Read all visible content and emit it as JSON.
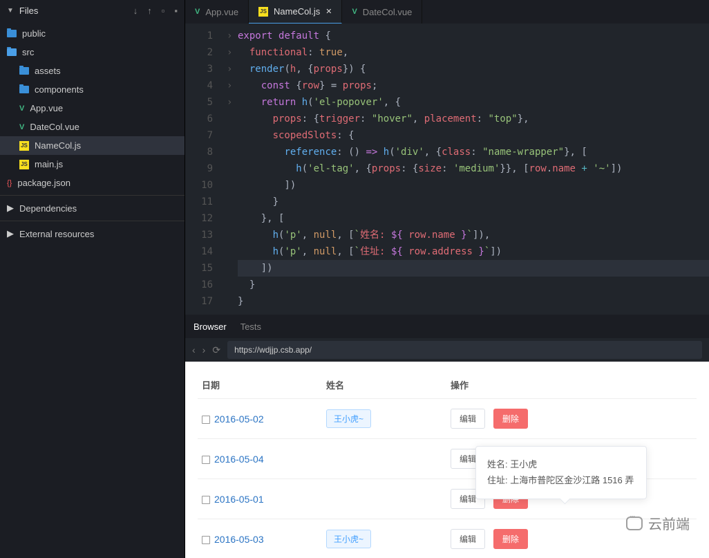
{
  "sidebar": {
    "title": "Files",
    "sections": {
      "deps": "Dependencies",
      "ext": "External resources"
    },
    "items": [
      {
        "name": "public",
        "icon": "folder",
        "depth": 0
      },
      {
        "name": "src",
        "icon": "folder-open",
        "depth": 0
      },
      {
        "name": "assets",
        "icon": "folder",
        "depth": 1
      },
      {
        "name": "components",
        "icon": "folder",
        "depth": 1
      },
      {
        "name": "App.vue",
        "icon": "vue",
        "depth": 1
      },
      {
        "name": "DateCol.vue",
        "icon": "vue",
        "depth": 1
      },
      {
        "name": "NameCol.js",
        "icon": "js",
        "depth": 1,
        "active": true
      },
      {
        "name": "main.js",
        "icon": "js",
        "depth": 1
      },
      {
        "name": "package.json",
        "icon": "json",
        "depth": 0
      }
    ]
  },
  "editor": {
    "tabs": [
      {
        "label": "App.vue",
        "icon": "vue"
      },
      {
        "label": "NameCol.js",
        "icon": "js",
        "active": true,
        "dirty": true
      },
      {
        "label": "DateCol.vue",
        "icon": "vue"
      }
    ]
  },
  "code": {
    "tokens": {
      "export": "export",
      "default": "default",
      "brace_o": "{",
      "brace_c": "}",
      "functional": "functional",
      "true": "true",
      "render": "render",
      "h_param": "h",
      "props_param": "props",
      "const": "const",
      "row": "row",
      "eq": " = ",
      "semi": ";",
      "return": "return",
      "h_call": "h",
      "el_popover": "'el-popover'",
      "props_key": "props",
      "trigger": "trigger",
      "hover": "\"hover\"",
      "placement": "placement",
      "top": "\"top\"",
      "scopedSlots": "scopedSlots",
      "reference": "reference",
      "arrow": "=>",
      "div": "'div'",
      "class": "class",
      "name_wrapper": "\"name-wrapper\"",
      "el_tag": "'el-tag'",
      "size": "size",
      "medium": "'medium'",
      "name_prop": "name",
      "tilde": "'~'",
      "p_tag": "'p'",
      "null": "null",
      "name_label": "姓名:",
      "addr_label": "住址:",
      "row_name": "row.name",
      "row_address": "row.address",
      "dollar_o": "${ ",
      "dollar_c": " }"
    }
  },
  "preview": {
    "tabs": {
      "browser": "Browser",
      "tests": "Tests"
    },
    "url": "https://wdjjp.csb.app/",
    "headers": {
      "date": "日期",
      "name": "姓名",
      "action": "操作"
    },
    "buttons": {
      "edit": "编辑",
      "delete": "删除"
    },
    "rows": [
      {
        "date": "2016-05-02",
        "name": "王小虎~"
      },
      {
        "date": "2016-05-04",
        "name": ""
      },
      {
        "date": "2016-05-01",
        "name": ""
      },
      {
        "date": "2016-05-03",
        "name": "王小虎~"
      }
    ],
    "popover": {
      "line1": "姓名: 王小虎",
      "line2": "住址: 上海市普陀区金沙江路 1516 弄"
    }
  },
  "watermark": "云前端"
}
